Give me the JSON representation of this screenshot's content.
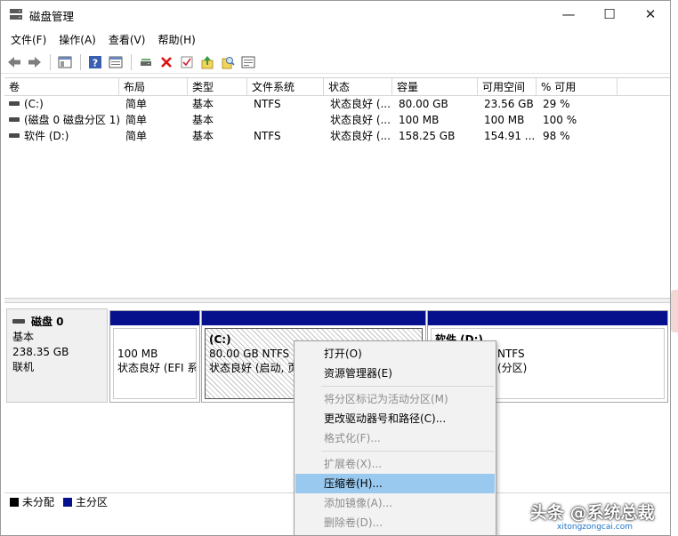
{
  "window": {
    "title": "磁盘管理",
    "minimize_glyph": "—",
    "maximize_glyph": "☐",
    "close_glyph": "✕"
  },
  "menu": [
    "文件(F)",
    "操作(A)",
    "查看(V)",
    "帮助(H)"
  ],
  "toolbar_icons": [
    "back-icon",
    "forward-icon",
    "console-tree-icon",
    "help-icon",
    "properties-icon",
    "connect-drive-icon",
    "delete-icon",
    "check-icon",
    "export-icon",
    "search-icon",
    "rescan-icon"
  ],
  "table": {
    "columns": [
      "卷",
      "布局",
      "类型",
      "文件系统",
      "状态",
      "容量",
      "可用空间",
      "% 可用"
    ],
    "rows": [
      [
        "(C:)",
        "简单",
        "基本",
        "NTFS",
        "状态良好 (...",
        "80.00 GB",
        "23.56 GB",
        "29 %"
      ],
      [
        "(磁盘 0 磁盘分区 1)",
        "简单",
        "基本",
        "",
        "状态良好 (...",
        "100 MB",
        "100 MB",
        "100 %"
      ],
      [
        "软件 (D:)",
        "简单",
        "基本",
        "NTFS",
        "状态良好 (...",
        "158.25 GB",
        "154.91 ...",
        "98 %"
      ]
    ]
  },
  "disk": {
    "name": "磁盘 0",
    "type": "基本",
    "size": "238.35 GB",
    "status": "联机",
    "partitions": [
      {
        "title": "",
        "size": "100 MB",
        "status": "状态良好 (EFI 系"
      },
      {
        "title": "(C:)",
        "size": "80.00 GB NTFS",
        "status": "状态良好 (启动, 页"
      },
      {
        "title": "软件 (D:)",
        "size": "NTFS",
        "status": "(分区)"
      }
    ]
  },
  "legend": [
    {
      "label": "未分配",
      "color": "#000000"
    },
    {
      "label": "主分区",
      "color": "#06108c"
    }
  ],
  "context_menu": [
    {
      "label": "打开(O)",
      "disabled": false
    },
    {
      "label": "资源管理器(E)",
      "disabled": false
    },
    {
      "sep": true
    },
    {
      "label": "将分区标记为活动分区(M)",
      "disabled": true
    },
    {
      "label": "更改驱动器号和路径(C)...",
      "disabled": false
    },
    {
      "label": "格式化(F)...",
      "disabled": true
    },
    {
      "sep": true
    },
    {
      "label": "扩展卷(X)...",
      "disabled": true
    },
    {
      "label": "压缩卷(H)...",
      "disabled": false,
      "highlighted": true
    },
    {
      "label": "添加镜像(A)...",
      "disabled": true
    },
    {
      "label": "删除卷(D)...",
      "disabled": true
    }
  ],
  "watermark": {
    "text": "头条 @系统总裁",
    "sub": "xitongzongcai.com"
  }
}
